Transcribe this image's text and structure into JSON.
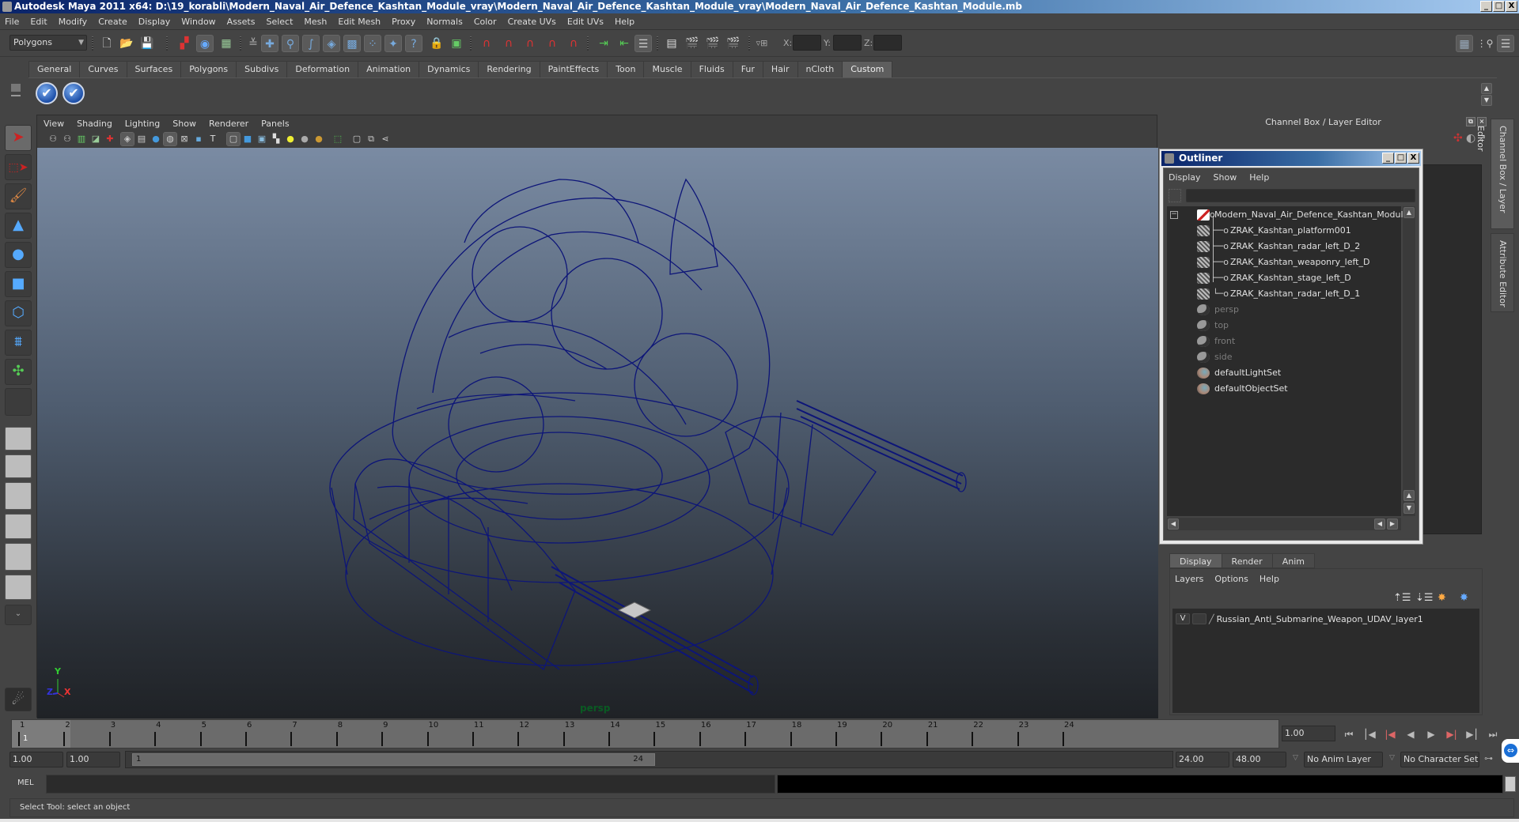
{
  "window": {
    "title": "Autodesk Maya 2011 x64: D:\\19_korabli\\Modern_Naval_Air_Defence_Kashtan_Module_vray\\Modern_Naval_Air_Defence_Kashtan_Module_vray\\Modern_Naval_Air_Defence_Kashtan_Module.mb",
    "buttons": {
      "minimize": "_",
      "maximize": "□",
      "close": "X"
    }
  },
  "menubar": [
    "File",
    "Edit",
    "Modify",
    "Create",
    "Display",
    "Window",
    "Assets",
    "Select",
    "Mesh",
    "Edit Mesh",
    "Proxy",
    "Normals",
    "Color",
    "Create UVs",
    "Edit UVs",
    "Help"
  ],
  "toolbar": {
    "menuset": "Polygons",
    "icons": [
      "new-scene",
      "open-scene",
      "save-scene",
      "select-by-hierarchy",
      "select-by-object-type",
      "select-by-component-type",
      "lock-selection",
      "select-handles",
      "select-joints",
      "select-curves",
      "select-surfaces",
      "select-deformations",
      "select-dynamics",
      "select-rendering",
      "select-misc",
      "highlight-selection",
      "snap-to-grid",
      "snap-to-curve",
      "snap-to-point",
      "snap-to-view-plane",
      "make-live",
      "input-ops",
      "output-ops",
      "construction-history",
      "render-view",
      "render-current-frame",
      "ipr-render",
      "render-settings"
    ],
    "transform_labels": {
      "x": "X:",
      "y": "Y:",
      "z": "Z:"
    },
    "transform_values": {
      "x": "",
      "y": "",
      "z": ""
    }
  },
  "shelf": {
    "tabs": [
      "General",
      "Curves",
      "Surfaces",
      "Polygons",
      "Subdivs",
      "Deformation",
      "Animation",
      "Dynamics",
      "Rendering",
      "PaintEffects",
      "Toon",
      "Muscle",
      "Fluids",
      "Fur",
      "Hair",
      "nCloth",
      "Custom"
    ],
    "active_tab": "Custom",
    "buttons": [
      "✔",
      "✔"
    ]
  },
  "toolbox": {
    "tools": [
      "select-tool",
      "lasso-tool",
      "paint-select-tool",
      "move-tool",
      "rotate-tool",
      "scale-tool",
      "universal-manipulator",
      "soft-modification-tool",
      "show-manipulator-tool",
      "last-tool"
    ],
    "active": "select-tool",
    "more_label": "⌄"
  },
  "viewport": {
    "menu": [
      "View",
      "Shading",
      "Lighting",
      "Show",
      "Renderer",
      "Panels"
    ],
    "camera_label": "persp",
    "axis": {
      "x": "X",
      "y": "Y",
      "z": "Z"
    }
  },
  "channel_box": {
    "title": "Channel Box / Layer Editor"
  },
  "side_tabs": [
    "Channel Box / Layer Editor",
    "Attribute Editor"
  ],
  "outliner": {
    "title": "Outliner",
    "menu": [
      "Display",
      "Show",
      "Help"
    ],
    "search_value": "",
    "items": [
      {
        "label": "Modern_Naval_Air_Defence_Kashtan_Module",
        "type": "transform",
        "depth": 0,
        "expanded": true
      },
      {
        "label": "ZRAK_Kashtan_platform001",
        "type": "mesh",
        "depth": 1
      },
      {
        "label": "ZRAK_Kashtan_radar_left_D_2",
        "type": "mesh",
        "depth": 1
      },
      {
        "label": "ZRAK_Kashtan_weaponry_left_D",
        "type": "mesh",
        "depth": 1
      },
      {
        "label": "ZRAK_Kashtan_stage_left_D",
        "type": "mesh",
        "depth": 1
      },
      {
        "label": "ZRAK_Kashtan_radar_left_D_1",
        "type": "mesh",
        "depth": 1
      },
      {
        "label": "persp",
        "type": "camera",
        "depth": 0
      },
      {
        "label": "top",
        "type": "camera",
        "depth": 0
      },
      {
        "label": "front",
        "type": "camera",
        "depth": 0
      },
      {
        "label": "side",
        "type": "camera",
        "depth": 0
      },
      {
        "label": "defaultLightSet",
        "type": "set",
        "depth": 0
      },
      {
        "label": "defaultObjectSet",
        "type": "set",
        "depth": 0
      }
    ]
  },
  "layer_editor": {
    "tabs": [
      "Display",
      "Render",
      "Anim"
    ],
    "active_tab": "Display",
    "menu": [
      "Layers",
      "Options",
      "Help"
    ],
    "layers": [
      {
        "visible": "V",
        "template": "",
        "name": "Russian_Anti_Submarine_Weapon_UDAV_layer1"
      }
    ]
  },
  "timeline": {
    "start": 1,
    "end": 24,
    "ticks": [
      "1",
      "2",
      "3",
      "4",
      "5",
      "6",
      "7",
      "8",
      "9",
      "10",
      "11",
      "12",
      "13",
      "14",
      "15",
      "16",
      "17",
      "18",
      "19",
      "20",
      "21",
      "22",
      "23",
      "24"
    ],
    "current_frame": "1",
    "current_frame_field": "1.00",
    "playback_buttons": [
      "go-to-start",
      "step-back-key",
      "step-back-frame",
      "play-backwards",
      "play-forwards",
      "step-forward-frame",
      "step-forward-key",
      "go-to-end"
    ]
  },
  "range_slider": {
    "anim_start": "1.00",
    "playback_start": "1.00",
    "range_start_label": "1",
    "range_end_label": "24",
    "playback_end": "24.00",
    "anim_end": "48.00",
    "anim_layer": "No Anim Layer",
    "character_set": "No Character Set"
  },
  "command_line": {
    "label": "MEL",
    "input": "",
    "output": ""
  },
  "help_line": "Select Tool: select an object"
}
